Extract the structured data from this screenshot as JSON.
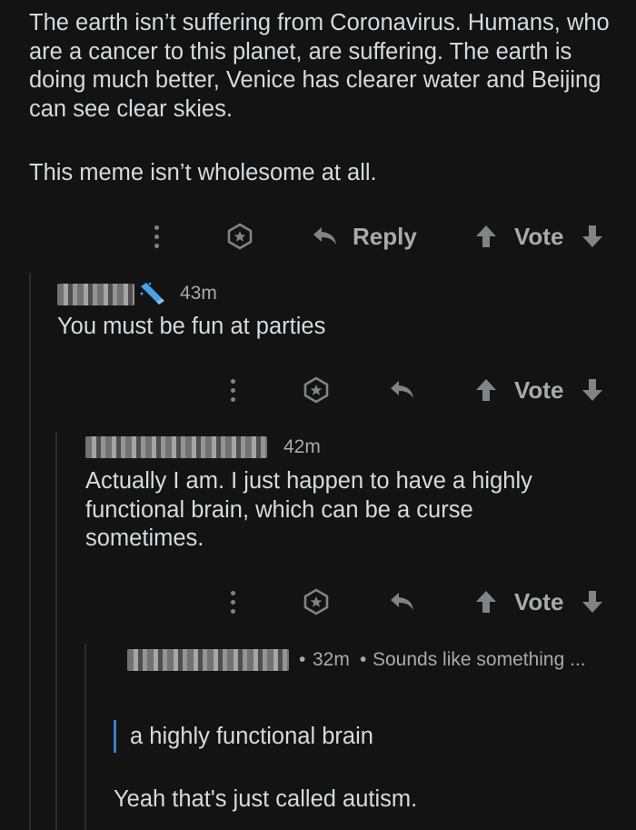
{
  "top_comment": {
    "paragraphs": [
      "The earth isn’t suffering from Coronavirus. Humans, who are a cancer to this planet, are suffering. The earth is doing much better, Venice has clearer water and Beijing can see clear skies.",
      "This meme isn’t wholesome at all."
    ],
    "actions": {
      "reply_label": "Reply",
      "vote_label": "Vote"
    }
  },
  "reply1": {
    "time": "43m",
    "body": "You must be fun at parties",
    "actions": {
      "vote_label": "Vote"
    }
  },
  "reply2": {
    "time": "42m",
    "body": "Actually I am. I just happen to have a highly functional brain, which can be a curse sometimes.",
    "actions": {
      "vote_label": "Vote"
    }
  },
  "reply3": {
    "time": "32m",
    "separator": "•",
    "preview": "Sounds like something ...",
    "quote": "a highly functional brain",
    "body": "Yeah that's just called autism."
  },
  "colors": {
    "background": "#131313",
    "text": "#d7dadc",
    "meta": "#a8aaab",
    "quote_bar": "#3a7fcf",
    "mod_badge": "#4aa3e8"
  },
  "icons": [
    "more-options-icon",
    "award-icon",
    "reply-arrow-icon",
    "upvote-arrow-icon",
    "downvote-arrow-icon",
    "mod-wand-icon"
  ]
}
